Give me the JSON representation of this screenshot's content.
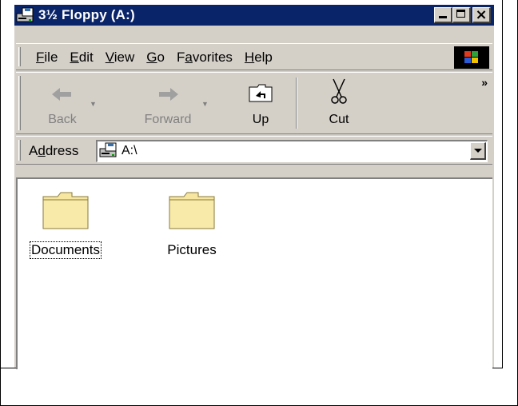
{
  "window": {
    "title": "3½ Floppy (A:)",
    "title_bar_color": "#0a246a"
  },
  "caption_buttons": {
    "minimize_icon": "minimize-icon",
    "maximize_icon": "maximize-icon",
    "close_glyph": "×"
  },
  "menubar": {
    "items": [
      {
        "label": "File",
        "mnemonic": "F"
      },
      {
        "label": "Edit",
        "mnemonic": "E"
      },
      {
        "label": "View",
        "mnemonic": "V"
      },
      {
        "label": "Go",
        "mnemonic": "G"
      },
      {
        "label": "Favorites",
        "mnemonic": "a"
      },
      {
        "label": "Help",
        "mnemonic": "H"
      }
    ]
  },
  "toolbar": {
    "back_label": "Back",
    "forward_label": "Forward",
    "up_label": "Up",
    "cut_label": "Cut",
    "overflow_glyph": "»"
  },
  "address": {
    "label": "Address",
    "mnemonic": "d",
    "value": "A:\\"
  },
  "files": [
    {
      "name": "Documents",
      "type": "folder",
      "focused": true
    },
    {
      "name": "Pictures",
      "type": "folder",
      "focused": false
    }
  ]
}
